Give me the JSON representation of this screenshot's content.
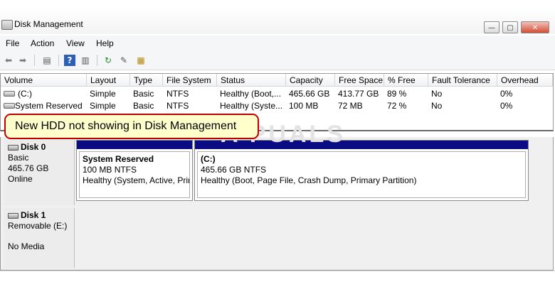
{
  "window": {
    "title": "Disk Management"
  },
  "menu": [
    "File",
    "Action",
    "View",
    "Help"
  ],
  "toolbar_icons": [
    "back-arrow-icon",
    "forward-arrow-icon",
    "show-hide-console-tree-icon",
    "help-icon",
    "show-action-pane-icon",
    "refresh-icon",
    "properties-icon",
    "help-topics-icon"
  ],
  "columns": [
    "Volume",
    "Layout",
    "Type",
    "File System",
    "Status",
    "Capacity",
    "Free Space",
    "% Free",
    "Fault Tolerance",
    "Overhead"
  ],
  "volumes": [
    {
      "volume": "(C:)",
      "layout": "Simple",
      "type": "Basic",
      "fs": "NTFS",
      "status": "Healthy (Boot,...",
      "capacity": "465.66 GB",
      "free": "413.77 GB",
      "pct": "89 %",
      "fault": "No",
      "overhead": "0%"
    },
    {
      "volume": "System Reserved",
      "layout": "Simple",
      "type": "Basic",
      "fs": "NTFS",
      "status": "Healthy (Syste...",
      "capacity": "100 MB",
      "free": "72 MB",
      "pct": "72 %",
      "fault": "No",
      "overhead": "0%"
    }
  ],
  "callout": "New HDD not showing in Disk Management",
  "watermark": "A PUALS",
  "disks": [
    {
      "name": "Disk 0",
      "type": "Basic",
      "size": "465.76 GB",
      "state": "Online"
    },
    {
      "name": "Disk 1",
      "type": "Removable (E:)",
      "media": "No Media"
    }
  ],
  "partitions": [
    {
      "title": "System Reserved",
      "size": "100 MB NTFS",
      "status": "Healthy (System, Active, Primary Partition)"
    },
    {
      "title": "(C:)",
      "size": "465.66 GB NTFS",
      "status": "Healthy (Boot, Page File, Crash Dump, Primary Partition)"
    }
  ],
  "colors": {
    "partition_bar": "#0b0b84",
    "callout_border": "#c00000",
    "callout_bg": "#ffffcc"
  }
}
